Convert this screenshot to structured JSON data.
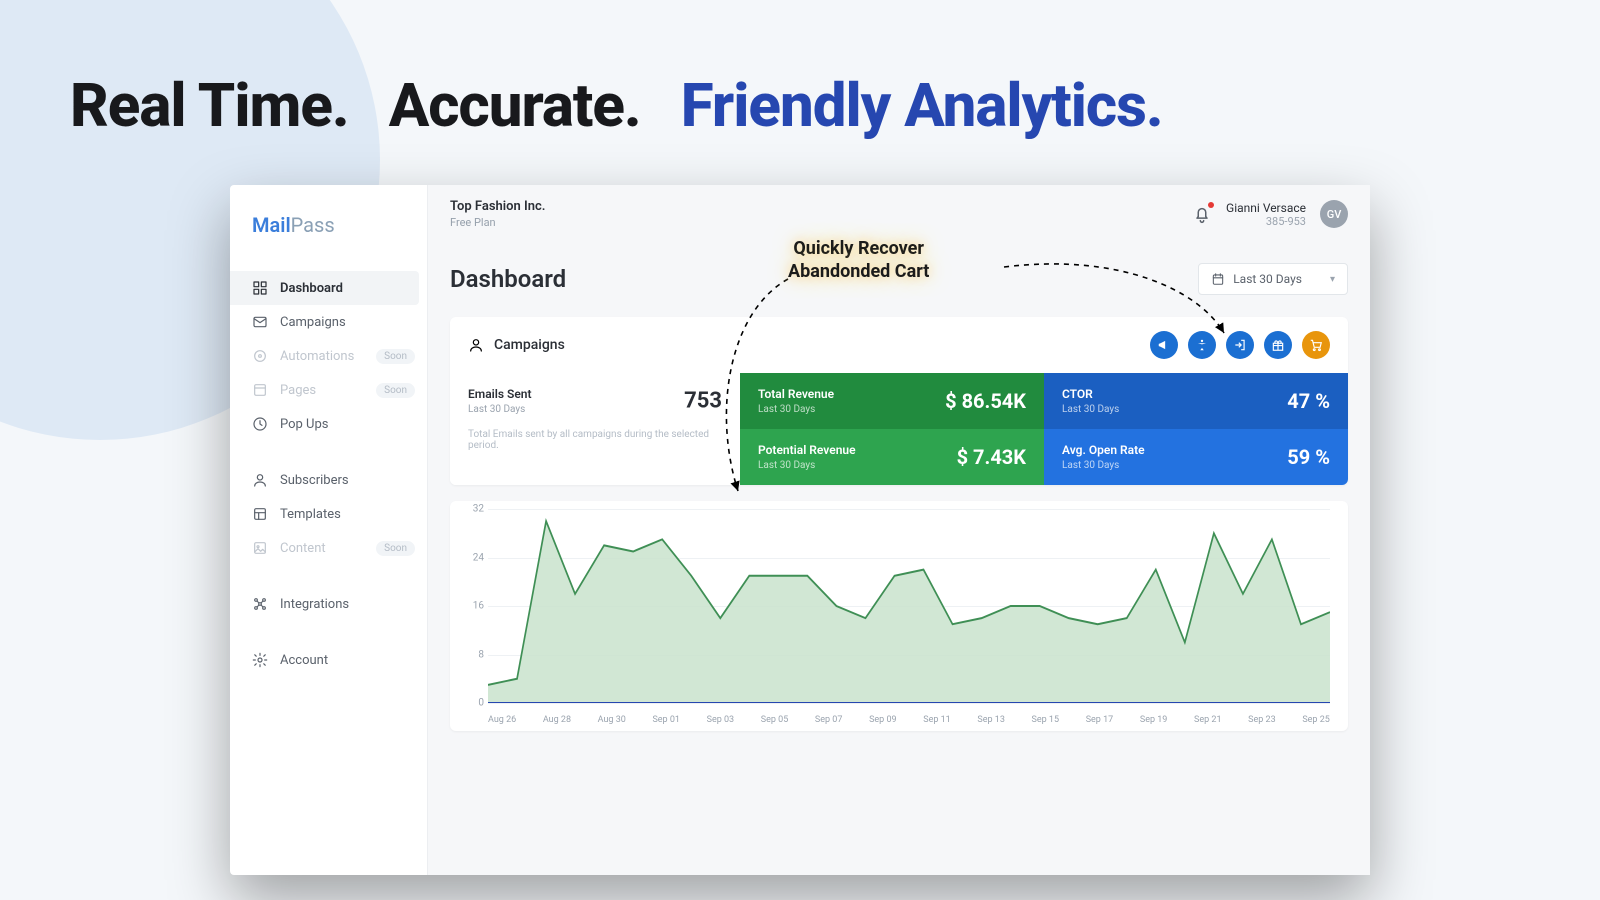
{
  "hero": {
    "word1": "Real Time.",
    "word2": "Accurate.",
    "word3": "Friendly Analytics."
  },
  "brand": {
    "part1": "Mail",
    "part2": "Pass"
  },
  "sidebar": {
    "items": [
      {
        "label": "Dashboard"
      },
      {
        "label": "Campaigns"
      },
      {
        "label": "Automations",
        "badge": "Soon"
      },
      {
        "label": "Pages",
        "badge": "Soon"
      },
      {
        "label": "Pop Ups"
      }
    ],
    "group2": [
      {
        "label": "Subscribers"
      },
      {
        "label": "Templates"
      },
      {
        "label": "Content",
        "badge": "Soon"
      }
    ],
    "group3": [
      {
        "label": "Integrations"
      }
    ],
    "group4": [
      {
        "label": "Account"
      }
    ]
  },
  "topbar": {
    "company": "Top Fashion Inc.",
    "plan": "Free Plan",
    "user_name": "Gianni Versace",
    "user_id": "385-953",
    "avatar_initials": "GV"
  },
  "page": {
    "title": "Dashboard",
    "date_range": "Last 30 Days"
  },
  "campaigns": {
    "heading": "Campaigns",
    "emails_sent_label": "Emails Sent",
    "emails_sent_sub": "Last 30 Days",
    "emails_sent_value": "753",
    "footnote": "Total Emails sent by all campaigns during the selected period.",
    "total_rev_label": "Total Revenue",
    "total_rev_sub": "Last 30 Days",
    "total_rev_value": "$ 86.54K",
    "pot_rev_label": "Potential Revenue",
    "pot_rev_sub": "Last 30 Days",
    "pot_rev_value": "$ 7.43K",
    "ctor_label": "CTOR",
    "ctor_sub": "Last 30 Days",
    "ctor_value": "47 %",
    "open_label": "Avg. Open Rate",
    "open_sub": "Last 30 Days",
    "open_value": "59 %"
  },
  "callout": {
    "line1": "Quickly Recover",
    "line2": "Abandonded Cart"
  },
  "chart_data": {
    "type": "area",
    "title": "",
    "xlabel": "",
    "ylabel": "",
    "ylim": [
      0,
      32
    ],
    "y_ticks": [
      0,
      8,
      16,
      24,
      32
    ],
    "categories": [
      "Aug 26",
      "Aug 28",
      "Aug 30",
      "Sep 01",
      "Sep 03",
      "Sep 05",
      "Sep 07",
      "Sep 09",
      "Sep 11",
      "Sep 13",
      "Sep 15",
      "Sep 17",
      "Sep 19",
      "Sep 21",
      "Sep 23",
      "Sep 25"
    ],
    "values": [
      3,
      4,
      30,
      18,
      26,
      25,
      27,
      21,
      14,
      21,
      21,
      21,
      16,
      14,
      21,
      22,
      13,
      14,
      16,
      16,
      14,
      13,
      14,
      22,
      10,
      28,
      18,
      27,
      13,
      15
    ]
  }
}
